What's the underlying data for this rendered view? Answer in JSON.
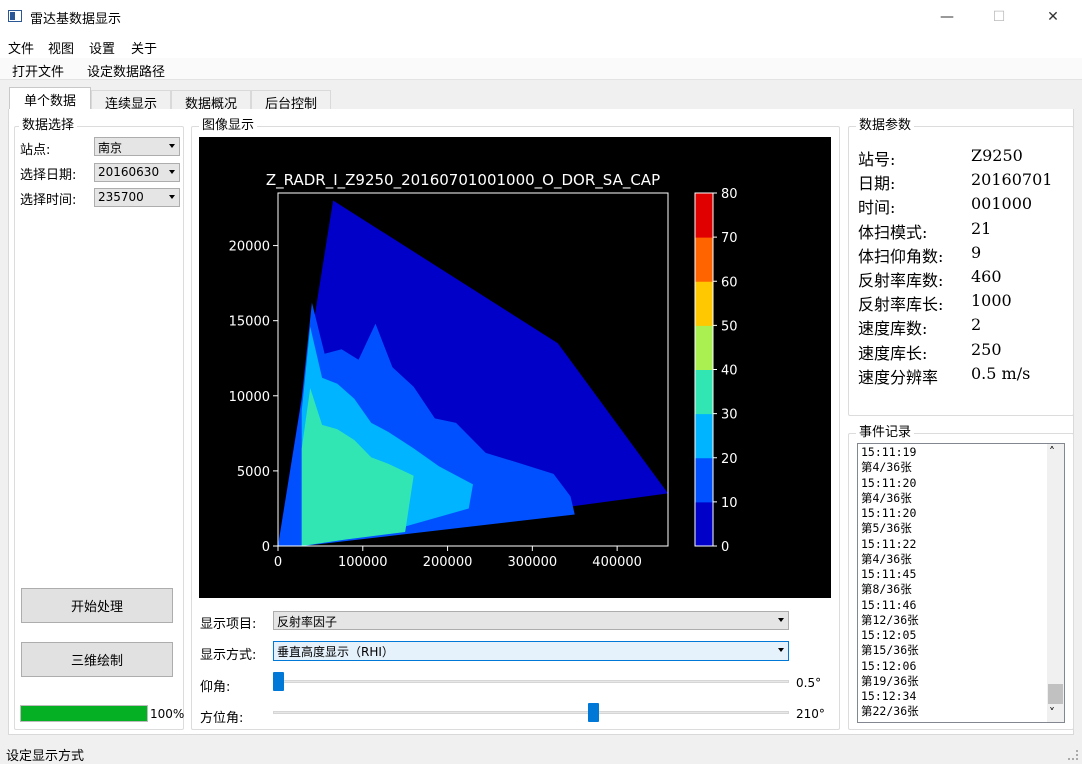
{
  "window": {
    "title": "雷达基数据显示",
    "minimize_glyph": "—",
    "maximize_glyph": "☐",
    "close_glyph": "✕"
  },
  "menu": {
    "items": [
      "文件",
      "视图",
      "设置",
      "关于"
    ]
  },
  "toolbar": {
    "items": [
      "打开文件",
      "设定数据路径"
    ]
  },
  "tabs": [
    "单个数据",
    "连续显示",
    "数据概况",
    "后台控制"
  ],
  "data_select": {
    "group_title": "数据选择",
    "station_label": "站点:",
    "station_value": "南京",
    "date_label": "选择日期:",
    "date_value": "20160630",
    "time_label": "选择时间:",
    "time_value": "235700"
  },
  "buttons": {
    "start": "开始处理",
    "three_d": "三维绘制"
  },
  "progress": {
    "value": 1.0,
    "label": "100%"
  },
  "image": {
    "group_title": "图像显示",
    "display_item_label": "显示项目:",
    "display_item_value": "反射率因子",
    "display_mode_label": "显示方式:",
    "display_mode_value": "垂直高度显示（RHI）",
    "elevation_label": "仰角:",
    "elevation_value_text": "0.5°",
    "elevation_fraction": 0.0,
    "azimuth_label": "方位角:",
    "azimuth_value_text": "210°",
    "azimuth_fraction": 0.6
  },
  "chart_data": {
    "type": "heatmap",
    "title": "Z_RADR_I_Z9250_20160701001000_O_DOR_SA_CAP",
    "xlabel": "",
    "ylabel": "",
    "x_ticks": [
      "0",
      "100000",
      "200000",
      "300000",
      "400000"
    ],
    "y_ticks": [
      "0",
      "5000",
      "10000",
      "15000",
      "20000"
    ],
    "xlim": [
      0,
      460000
    ],
    "ylim": [
      0,
      23500
    ],
    "colorbar_ticks": [
      "0",
      "10",
      "20",
      "30",
      "40",
      "50",
      "60",
      "70",
      "80"
    ],
    "colorbar_range": [
      0,
      80
    ],
    "colors": [
      "#0000c8",
      "#0050ff",
      "#00b4ff",
      "#32e6b4",
      "#aaf050",
      "#ffc800",
      "#ff6400",
      "#e10000"
    ],
    "background": "#000000",
    "envelope": [
      [
        0,
        0
      ],
      [
        65000,
        23000
      ],
      [
        330000,
        13500
      ],
      [
        460000,
        3500
      ],
      [
        0,
        0
      ]
    ],
    "echo_top_profile": [
      [
        0,
        0
      ],
      [
        28000,
        9800
      ],
      [
        40000,
        16200
      ],
      [
        55000,
        12800
      ],
      [
        75000,
        13100
      ],
      [
        95000,
        12400
      ],
      [
        115000,
        14800
      ],
      [
        135000,
        11900
      ],
      [
        160000,
        10600
      ],
      [
        185000,
        8500
      ],
      [
        210000,
        8200
      ],
      [
        245000,
        6200
      ],
      [
        280000,
        5600
      ],
      [
        325000,
        4800
      ],
      [
        345000,
        3300
      ],
      [
        350000,
        2100
      ],
      [
        30000,
        0
      ]
    ],
    "moderate_echo_profile": [
      [
        28000,
        0
      ],
      [
        28000,
        9000
      ],
      [
        38000,
        14600
      ],
      [
        52000,
        11200
      ],
      [
        70000,
        10800
      ],
      [
        90000,
        9800
      ],
      [
        110000,
        8200
      ],
      [
        130000,
        7600
      ],
      [
        160000,
        6500
      ],
      [
        190000,
        5300
      ],
      [
        230000,
        4100
      ],
      [
        225000,
        2500
      ],
      [
        150000,
        1300
      ],
      [
        80000,
        600
      ],
      [
        28000,
        0
      ]
    ]
  },
  "params": {
    "group_title": "数据参数",
    "rows": [
      {
        "label": "站号:",
        "value": "Z9250"
      },
      {
        "label": "日期:",
        "value": "20160701"
      },
      {
        "label": "时间:",
        "value": "001000"
      },
      {
        "label": "体扫模式:",
        "value": "21"
      },
      {
        "label": "体扫仰角数:",
        "value": "9"
      },
      {
        "label": "反射率库数:",
        "value": "460"
      },
      {
        "label": "反射率库长:",
        "value": "1000"
      },
      {
        "label": "速度库数:",
        "value": "2"
      },
      {
        "label": "速度库长:",
        "value": "250"
      },
      {
        "label": "速度分辨率",
        "value": "0.5 m/s"
      }
    ]
  },
  "events": {
    "group_title": "事件记录",
    "lines": [
      "15:11:19",
      "第4/36张",
      "15:11:20",
      "第4/36张",
      "15:11:20",
      "第5/36张",
      "15:11:22",
      "第4/36张",
      "15:11:45",
      "第8/36张",
      "15:11:46",
      "第12/36张",
      "15:12:05",
      "第15/36张",
      "15:12:06",
      "第19/36张",
      "15:12:34",
      "第22/36张"
    ],
    "scroll_up_glyph": "˄",
    "scroll_down_glyph": "˅"
  },
  "status_bar": {
    "text": "设定显示方式"
  }
}
